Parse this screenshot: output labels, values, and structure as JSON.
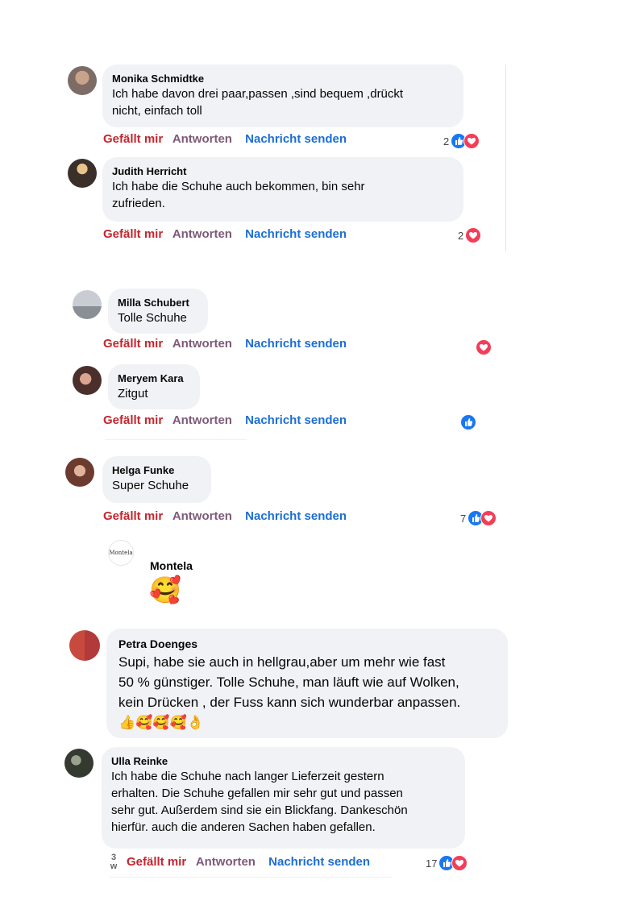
{
  "actions": {
    "like": "Gefällt mir",
    "reply": "Antworten",
    "message": "Nachricht senden"
  },
  "comments": [
    {
      "author": "Monika Schmidtke",
      "text": "Ich habe davon drei paar,passen ,sind bequem ,drückt\nnicht, einfach toll",
      "reaction_count": "2",
      "reactions": [
        "like-icon",
        "love-icon"
      ]
    },
    {
      "author": "Judith Herricht",
      "text": "Ich habe die Schuhe auch bekommen, bin sehr\nzufrieden.",
      "reaction_count": "2",
      "reactions": [
        "love-icon"
      ]
    },
    {
      "author": "Milla Schubert",
      "text": "Tolle Schuhe",
      "reaction_count": "",
      "reactions": [
        "love-icon"
      ]
    },
    {
      "author": "Meryem Kara",
      "text": "Zitgut",
      "reaction_count": "",
      "reactions": [
        "like-icon"
      ]
    },
    {
      "author": "Helga Funke",
      "text": "Super Schuhe",
      "reaction_count": "7",
      "reactions": [
        "like-icon",
        "love-icon"
      ]
    },
    {
      "author": "Montela",
      "text": "🥰",
      "logo_text": "Montela"
    },
    {
      "author": "Petra Doenges",
      "text": "Supi, habe sie auch in hellgrau,aber um mehr wie fast\n50 % günstiger. Tolle Schuhe, man läuft wie auf Wolken,\nkein Drücken , der Fuss kann sich wunderbar anpassen.\n👍🥰🥰🥰👌",
      "reaction_count": "",
      "reactions": []
    },
    {
      "author": "Ulla Reinke",
      "text": "Ich habe die Schuhe nach langer Lieferzeit gestern\nerhalten. Die Schuhe gefallen mir sehr gut und passen\nsehr gut. Außerdem sind sie ein Blickfang. Dankeschön\nhierfür. auch die anderen Sachen haben gefallen.",
      "reaction_count": "17",
      "reactions": [
        "like-icon",
        "love-icon"
      ],
      "time_number": "3",
      "time_unit": "w"
    }
  ],
  "colors": {
    "like": "#c4262e",
    "reply": "#7e5a78",
    "message": "#1c6ed6",
    "bubble": "#f0f2f5",
    "like_icon": "#1877f2",
    "love_icon": "#f33e58"
  }
}
